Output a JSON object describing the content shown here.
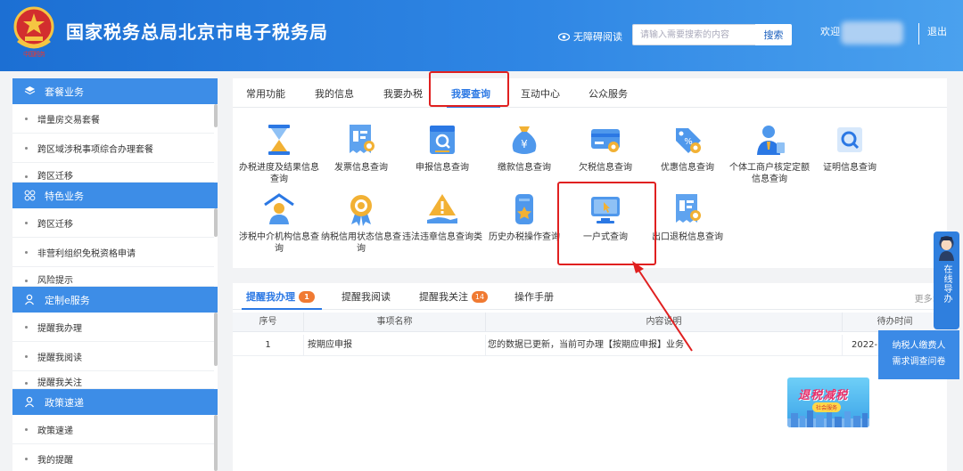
{
  "header": {
    "title": "国家税务总局北京市电子税务局",
    "emblem_caption": "中国税务",
    "accessibility_label": "无障碍阅读",
    "search_placeholder": "请输入需要搜索的内容",
    "search_button": "搜索",
    "welcome": "欢迎",
    "logout": "退出"
  },
  "sidebar": {
    "sections": [
      {
        "title": "套餐业务",
        "icon": "layers-icon",
        "items": [
          "增量房交易套餐",
          "跨区域涉税事项综合办理套餐",
          "跨区迁移"
        ]
      },
      {
        "title": "特色业务",
        "icon": "grid-icon",
        "items": [
          "跨区迁移",
          "非营利组织免税资格申请",
          "风险提示"
        ]
      },
      {
        "title": "定制e服务",
        "icon": "user-icon",
        "items": [
          "提醒我办理",
          "提醒我阅读",
          "提醒我关注"
        ]
      },
      {
        "title": "政策速递",
        "icon": "user-icon",
        "items": [
          "政策速递",
          "我的提醒"
        ]
      }
    ]
  },
  "main_tabs": [
    "常用功能",
    "我的信息",
    "我要办税",
    "我要查询",
    "互动中心",
    "公众服务"
  ],
  "active_tab_index": 3,
  "functions": [
    {
      "label": "办税进度及结果信息查询",
      "icon": "hourglass-icon"
    },
    {
      "label": "发票信息查询",
      "icon": "invoice-search-icon"
    },
    {
      "label": "申报信息查询",
      "icon": "declaration-search-icon"
    },
    {
      "label": "缴款信息查询",
      "icon": "money-bag-icon"
    },
    {
      "label": "欠税信息查询",
      "icon": "card-icon"
    },
    {
      "label": "优惠信息查询",
      "icon": "discount-tag-icon"
    },
    {
      "label": "个体工商户核定定额信息查询",
      "icon": "business-person-icon"
    },
    {
      "label": "证明信息查询",
      "icon": "certificate-search-icon"
    },
    {
      "label": "涉税中介机构信息查询",
      "icon": "agency-icon"
    },
    {
      "label": "纳税信用状态信息查询",
      "icon": "credit-medal-icon"
    },
    {
      "label": "违法违章信息查询类",
      "icon": "warning-hand-icon"
    },
    {
      "label": "历史办税操作查询",
      "icon": "history-star-icon"
    },
    {
      "label": "一户式查询",
      "icon": "monitor-cursor-icon"
    },
    {
      "label": "出口退税信息查询",
      "icon": "export-refund-icon"
    }
  ],
  "reminder_tabs": [
    {
      "label": "提醒我办理",
      "badge": "1"
    },
    {
      "label": "提醒我阅读",
      "badge": ""
    },
    {
      "label": "提醒我关注",
      "badge": "14"
    },
    {
      "label": "操作手册",
      "badge": ""
    }
  ],
  "more_label": "更多>",
  "table": {
    "headers": [
      "序号",
      "事项名称",
      "内容说明",
      "待办时间"
    ],
    "rows": [
      [
        "1",
        "按期应申报",
        "您的数据已更新，当前可办理【按期应申报】业务",
        "2022-"
      ]
    ]
  },
  "float": {
    "online_guide": "在线导办",
    "survey_line1": "纳税人缴费人",
    "survey_line2": "需求调查问卷",
    "promo_title": "退税减税",
    "promo_sub": "社会服务"
  },
  "colors": {
    "header_blue": "#1c6fd3",
    "accent": "#2b78e4",
    "highlight_red": "#e02020",
    "badge_orange": "#f07a32"
  }
}
